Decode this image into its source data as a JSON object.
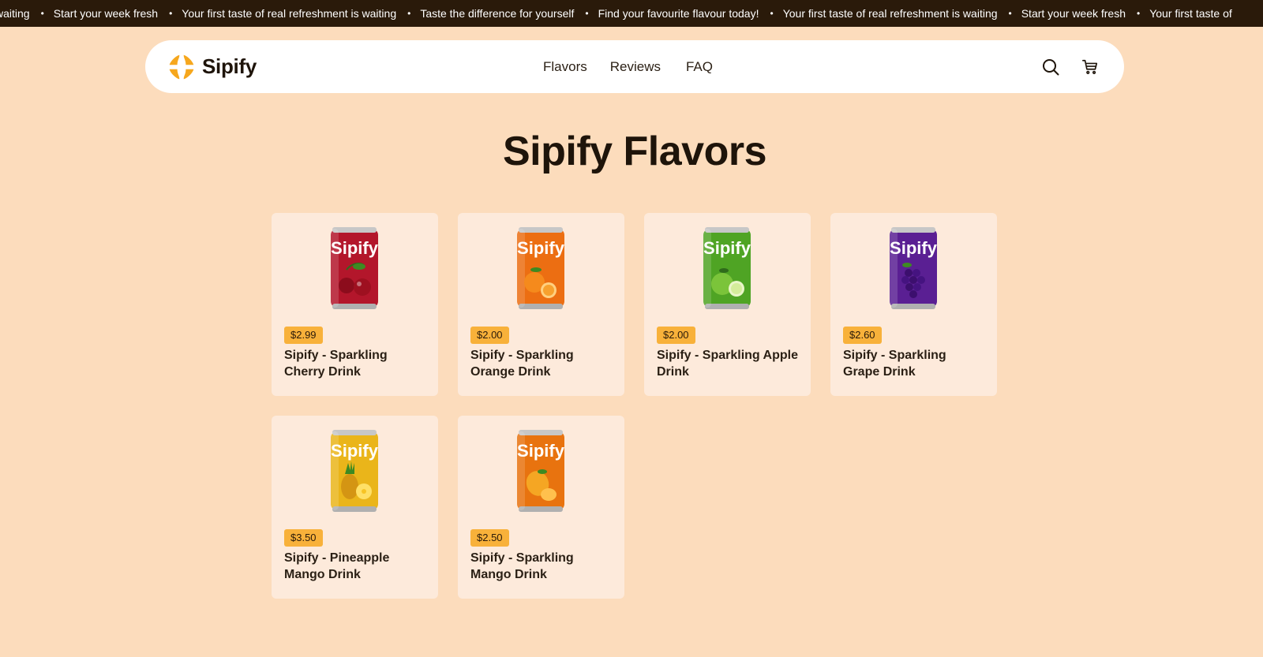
{
  "announcement": {
    "items": [
      "is waiting",
      "Start your week fresh",
      "Your first taste of real refreshment is waiting",
      "Taste the difference for yourself",
      "Find your favourite flavour today!",
      "Your first taste of real refreshment is waiting",
      "Start your week fresh",
      "Your first taste of"
    ],
    "bullet": "•"
  },
  "header": {
    "brand": "Sipify",
    "nav": [
      "Flavors",
      "Reviews",
      "FAQ"
    ],
    "icons": [
      "search-icon",
      "cart-icon"
    ]
  },
  "page": {
    "title": "Sipify Flavors"
  },
  "products": [
    {
      "price": "$2.99",
      "name": "Sipify - Sparkling Cherry Drink",
      "can_label": "Sipify",
      "can_color": "#b3162b",
      "fruit": "cherry"
    },
    {
      "price": "$2.00",
      "name": "Sipify - Sparkling Orange Drink",
      "can_label": "Sipify",
      "can_color": "#ec6e12",
      "fruit": "orange"
    },
    {
      "price": "$2.00",
      "name": "Sipify - Sparkling Apple Drink",
      "can_label": "Sipify",
      "can_color": "#4fa424",
      "fruit": "apple"
    },
    {
      "price": "$2.60",
      "name": "Sipify - Sparkling Grape Drink",
      "can_label": "Sipify",
      "can_color": "#5a1f93",
      "fruit": "grape"
    },
    {
      "price": "$3.50",
      "name": "Sipify - Pineapple Mango Drink",
      "can_label": "Sipify",
      "can_color": "#eab51a",
      "fruit": "pineapple"
    },
    {
      "price": "$2.50",
      "name": "Sipify - Sparkling Mango Drink",
      "can_label": "Sipify",
      "can_color": "#e8730f",
      "fruit": "mango"
    }
  ],
  "colors": {
    "background": "#fcdcbc",
    "marquee_bg": "#2a1a0a",
    "card_bg": "#fdeadb",
    "price_badge": "#f8b13a",
    "brand_logo": "#f6a71d"
  }
}
